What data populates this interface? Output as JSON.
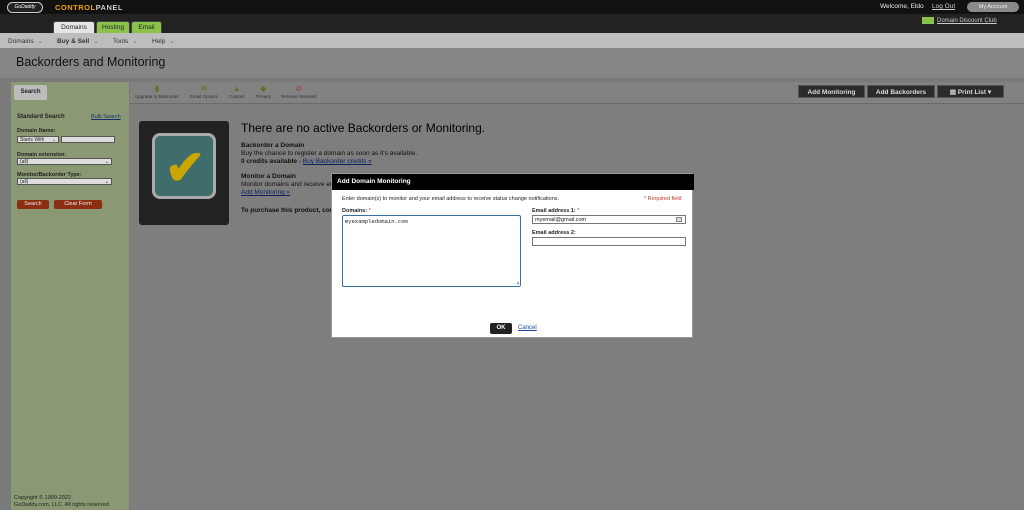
{
  "header": {
    "logo_text": "GoDaddy",
    "brand_go": "CONTROL",
    "brand_rest": "PANEL",
    "welcome": "Welcome, Eldo",
    "logout": "Log Out",
    "my_account": "My Account"
  },
  "tabs": [
    {
      "label": "Domains"
    },
    {
      "label": "Hosting"
    },
    {
      "label": "Email"
    }
  ],
  "discount_club": "Domain Discount Club",
  "menu": [
    {
      "label": "Domains"
    },
    {
      "label": "Buy & Sell"
    },
    {
      "label": "Tools"
    },
    {
      "label": "Help"
    }
  ],
  "page_title": "Backorders and Monitoring",
  "sidebar": {
    "tab": "Search",
    "standard_search": "Standard Search",
    "bulk_search": "Bulk Search",
    "domain_name_label": "Domain Name:",
    "starts_with": "Starts With",
    "extension_label": "Domain extension:",
    "extension_value": "(all)",
    "type_label": "Monitor/Backorder Type:",
    "type_value": "(all)",
    "search_btn": "Search",
    "clear_btn": "Clear Form",
    "copyright1": "Copyright © 1999-2022",
    "copyright2": "GoDaddy.com, LLC. All rights reserved."
  },
  "toolbar": {
    "upgrade": "Upgrade to Backorder",
    "email_options": "Email Options",
    "contact": "Contact",
    "privacy": "Privacy",
    "remove": "Remove Selected",
    "add_monitoring": "Add Monitoring",
    "add_backorders": "Add Backorders",
    "print_list": "Print List"
  },
  "main": {
    "heading": "There are no active Backorders or Monitoring.",
    "backorder_title": "Backorder a Domain",
    "backorder_desc": "Buy the chance to register a domain as soon as it's available.",
    "credits": "0 credits available",
    "credits_sep": " - ",
    "buy_credits": "Buy Backorder credits »",
    "monitor_title": "Monitor a Domain",
    "monitor_desc": "Monitor domains and receive em",
    "add_monitoring_link": "Add Monitoring »",
    "purchase": "To purchase this product, con"
  },
  "modal": {
    "title": "Add Domain Monitoring",
    "instructions": "Enter domain(s) to monitor and your email address to receive status change notifications.",
    "required": "Required field",
    "domains_label": "Domains:",
    "domains_value": "myexampledomain.com",
    "email1_label": "Email address 1:",
    "email1_value": "myemail@gmail.com",
    "email2_label": "Email address 2:",
    "email2_value": "",
    "ok": "OK",
    "cancel": "Cancel",
    "star": "*"
  }
}
